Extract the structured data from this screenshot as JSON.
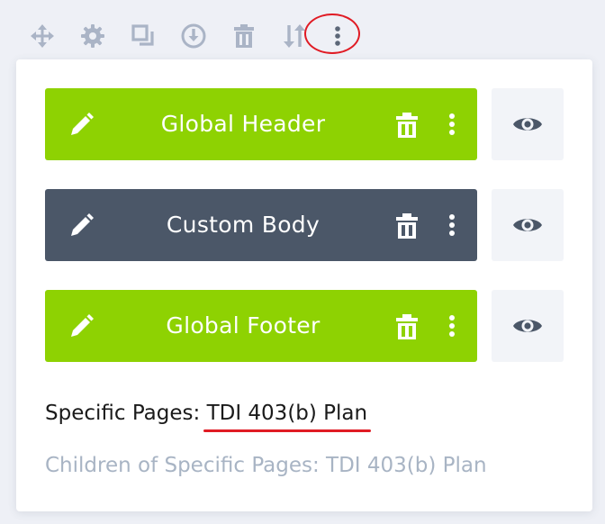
{
  "toolbar": {
    "icons": [
      "move-icon",
      "gear-icon",
      "duplicate-icon",
      "download-icon",
      "trash-icon",
      "sort-icon",
      "more-icon"
    ],
    "icon_color": "#aab4c6"
  },
  "templates": [
    {
      "title": "Global Header",
      "color": "#8ed202"
    },
    {
      "title": "Custom Body",
      "color": "#4b5768"
    },
    {
      "title": "Global Footer",
      "color": "#8ed202"
    }
  ],
  "assignment": {
    "label": "Specific Pages: ",
    "value": "TDI 403(b) Plan"
  },
  "children_assignment": "Children of Specific Pages: TDI 403(b) Plan",
  "annotation_color": "#e01b24"
}
